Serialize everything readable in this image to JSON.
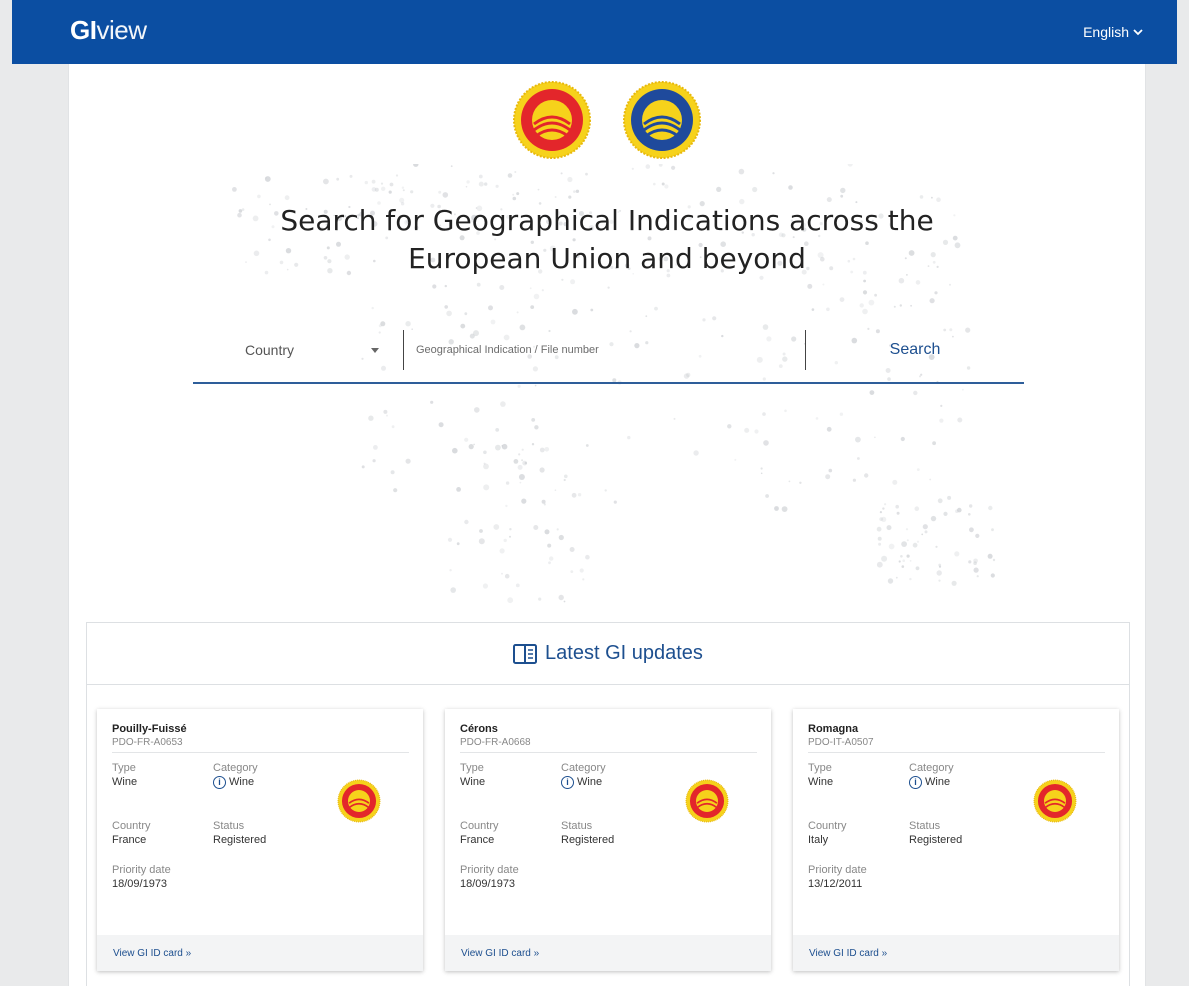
{
  "header": {
    "logo_bold": "GI",
    "logo_light": "view",
    "language": "English"
  },
  "hero": {
    "title_line1": "Search for Geographical Indications across the",
    "title_line2": "European Union and beyond"
  },
  "search": {
    "country_label": "Country",
    "input_placeholder": "Geographical Indication / File number",
    "button_label": "Search"
  },
  "updates": {
    "title": "Latest GI updates",
    "cards": [
      {
        "name": "Pouilly-Fuissé",
        "code": "PDO-FR-A0653",
        "type_label": "Type",
        "type_value": "Wine",
        "category_label": "Category",
        "category_value": "Wine",
        "country_label": "Country",
        "country_value": "France",
        "status_label": "Status",
        "status_value": "Registered",
        "priority_label": "Priority date",
        "priority_value": "18/09/1973",
        "link": "View GI ID card »"
      },
      {
        "name": "Cérons",
        "code": "PDO-FR-A0668",
        "type_label": "Type",
        "type_value": "Wine",
        "category_label": "Category",
        "category_value": "Wine",
        "country_label": "Country",
        "country_value": "France",
        "status_label": "Status",
        "status_value": "Registered",
        "priority_label": "Priority date",
        "priority_value": "18/09/1973",
        "link": "View GI ID card »"
      },
      {
        "name": "Romagna",
        "code": "PDO-IT-A0507",
        "type_label": "Type",
        "type_value": "Wine",
        "category_label": "Category",
        "category_value": "Wine",
        "country_label": "Country",
        "country_value": "Italy",
        "status_label": "Status",
        "status_value": "Registered",
        "priority_label": "Priority date",
        "priority_value": "13/12/2011",
        "link": "View GI ID card »"
      }
    ]
  },
  "icons": {
    "language_caret": "chevron-down-icon",
    "country_caret": "caret-down-icon",
    "updates_icon": "book-icon",
    "category_info": "info-icon",
    "pdo_seal": "pdo-seal-icon",
    "pgi_seal": "pgi-seal-icon"
  },
  "colors": {
    "brand_blue": "#0b4ea2",
    "link_blue": "#1d4f8f",
    "pdo_red": "#e3262b",
    "pdo_yellow": "#f6d21b",
    "pgi_blue": "#1f4a9c"
  }
}
